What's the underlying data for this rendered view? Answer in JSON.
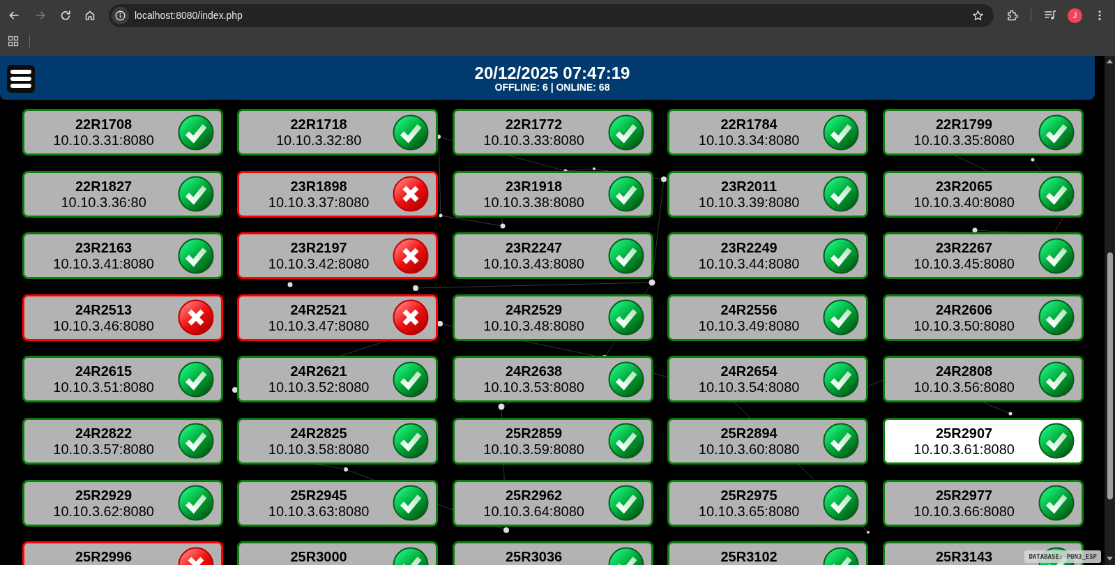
{
  "browser": {
    "url": "localhost:8080/index.php",
    "forward_disabled": true,
    "profile_initial": "J"
  },
  "header": {
    "datetime": "20/12/2025 07:47:19",
    "summary": "OFFLINE: 6 | ONLINE: 68"
  },
  "cards": [
    {
      "name": "22R1708",
      "address": "10.10.3.31:8080",
      "online": true,
      "selected": false
    },
    {
      "name": "22R1718",
      "address": "10.10.3.32:80",
      "online": true,
      "selected": false
    },
    {
      "name": "22R1772",
      "address": "10.10.3.33:8080",
      "online": true,
      "selected": false
    },
    {
      "name": "22R1784",
      "address": "10.10.3.34:8080",
      "online": true,
      "selected": false
    },
    {
      "name": "22R1799",
      "address": "10.10.3.35:8080",
      "online": true,
      "selected": false
    },
    {
      "name": "22R1827",
      "address": "10.10.3.36:80",
      "online": true,
      "selected": false
    },
    {
      "name": "23R1898",
      "address": "10.10.3.37:8080",
      "online": false,
      "selected": false
    },
    {
      "name": "23R1918",
      "address": "10.10.3.38:8080",
      "online": true,
      "selected": false
    },
    {
      "name": "23R2011",
      "address": "10.10.3.39:8080",
      "online": true,
      "selected": false
    },
    {
      "name": "23R2065",
      "address": "10.10.3.40:8080",
      "online": true,
      "selected": false
    },
    {
      "name": "23R2163",
      "address": "10.10.3.41:8080",
      "online": true,
      "selected": false
    },
    {
      "name": "23R2197",
      "address": "10.10.3.42:8080",
      "online": false,
      "selected": false
    },
    {
      "name": "23R2247",
      "address": "10.10.3.43:8080",
      "online": true,
      "selected": false
    },
    {
      "name": "23R2249",
      "address": "10.10.3.44:8080",
      "online": true,
      "selected": false
    },
    {
      "name": "23R2267",
      "address": "10.10.3.45:8080",
      "online": true,
      "selected": false
    },
    {
      "name": "24R2513",
      "address": "10.10.3.46:8080",
      "online": false,
      "selected": false
    },
    {
      "name": "24R2521",
      "address": "10.10.3.47:8080",
      "online": false,
      "selected": false
    },
    {
      "name": "24R2529",
      "address": "10.10.3.48:8080",
      "online": true,
      "selected": false
    },
    {
      "name": "24R2556",
      "address": "10.10.3.49:8080",
      "online": true,
      "selected": false
    },
    {
      "name": "24R2606",
      "address": "10.10.3.50:8080",
      "online": true,
      "selected": false
    },
    {
      "name": "24R2615",
      "address": "10.10.3.51:8080",
      "online": true,
      "selected": false
    },
    {
      "name": "24R2621",
      "address": "10.10.3.52:8080",
      "online": true,
      "selected": false
    },
    {
      "name": "24R2638",
      "address": "10.10.3.53:8080",
      "online": true,
      "selected": false
    },
    {
      "name": "24R2654",
      "address": "10.10.3.54:8080",
      "online": true,
      "selected": false
    },
    {
      "name": "24R2808",
      "address": "10.10.3.56:8080",
      "online": true,
      "selected": false
    },
    {
      "name": "24R2822",
      "address": "10.10.3.57:8080",
      "online": true,
      "selected": false
    },
    {
      "name": "24R2825",
      "address": "10.10.3.58:8080",
      "online": true,
      "selected": false
    },
    {
      "name": "25R2859",
      "address": "10.10.3.59:8080",
      "online": true,
      "selected": false
    },
    {
      "name": "25R2894",
      "address": "10.10.3.60:8080",
      "online": true,
      "selected": false
    },
    {
      "name": "25R2907",
      "address": "10.10.3.61:8080",
      "online": true,
      "selected": true
    },
    {
      "name": "25R2929",
      "address": "10.10.3.62:8080",
      "online": true,
      "selected": false
    },
    {
      "name": "25R2945",
      "address": "10.10.3.63:8080",
      "online": true,
      "selected": false
    },
    {
      "name": "25R2962",
      "address": "10.10.3.64:8080",
      "online": true,
      "selected": false
    },
    {
      "name": "25R2975",
      "address": "10.10.3.65:8080",
      "online": true,
      "selected": false
    },
    {
      "name": "25R2977",
      "address": "10.10.3.66:8080",
      "online": true,
      "selected": false
    },
    {
      "name": "25R2996",
      "online": false,
      "selected": false
    },
    {
      "name": "25R3000",
      "online": true,
      "selected": false
    },
    {
      "name": "25R3036",
      "online": true,
      "selected": false
    },
    {
      "name": "25R3102",
      "online": true,
      "selected": false
    },
    {
      "name": "25R3143",
      "online": true,
      "selected": false
    }
  ],
  "footer": {
    "database_label": "DATABASE: PON3_ESP"
  }
}
